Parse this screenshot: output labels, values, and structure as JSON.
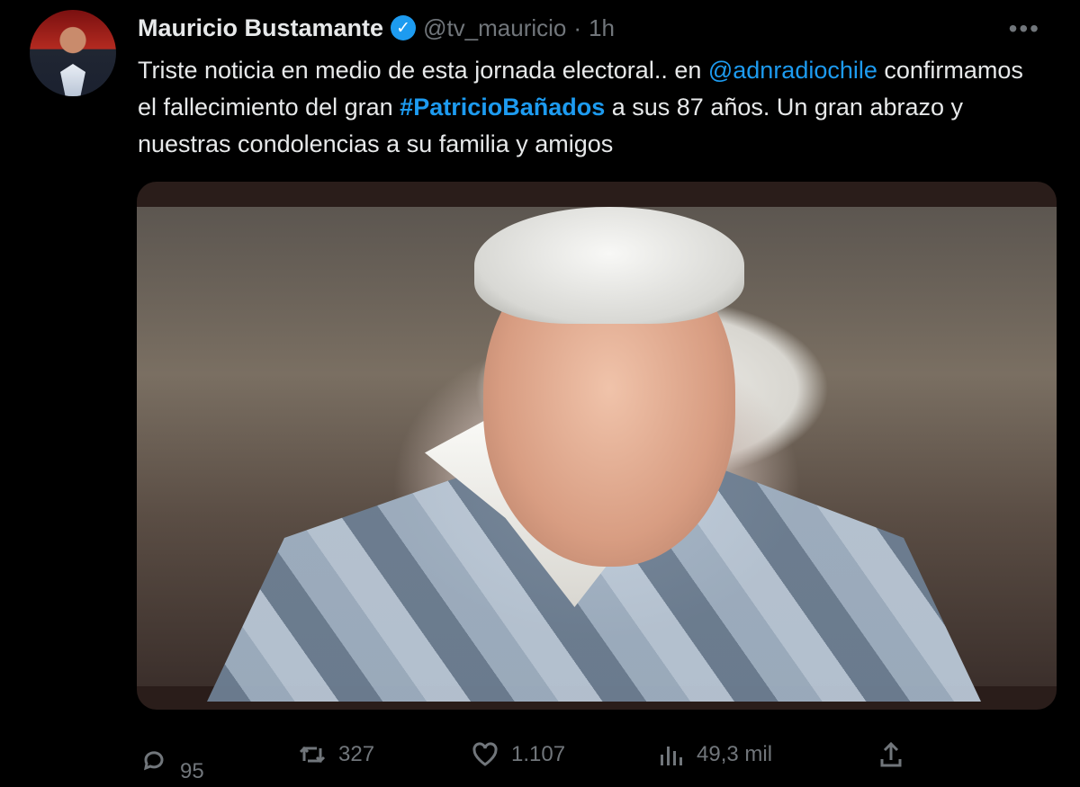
{
  "tweet": {
    "author_name": "Mauricio Bustamante",
    "handle": "@tv_mauricio",
    "separator": "·",
    "time": "1h",
    "more_label": "•••",
    "text_parts": [
      {
        "type": "text",
        "value": "Triste noticia en medio de esta jornada electoral.. en "
      },
      {
        "type": "mention",
        "value": "@adnradiochile"
      },
      {
        "type": "text",
        "value": " confirmamos el fallecimiento del gran "
      },
      {
        "type": "hashtag",
        "value": "#PatricioBañados"
      },
      {
        "type": "text",
        "value": " a sus 87 años. Un gran abrazo y nuestras condolencias a su familia y amigos"
      }
    ]
  },
  "actions": {
    "reply": {
      "icon": "reply-icon",
      "count": "95"
    },
    "retweet": {
      "icon": "retweet-icon",
      "count": "327"
    },
    "like": {
      "icon": "heart-icon",
      "count": "1.107"
    },
    "views": {
      "icon": "views-icon",
      "count": "49,3 mil"
    },
    "share": {
      "icon": "share-icon"
    }
  },
  "colors": {
    "background": "#000000",
    "text": "#e7e9ea",
    "muted": "#71767b",
    "accent": "#1d9bf0"
  }
}
